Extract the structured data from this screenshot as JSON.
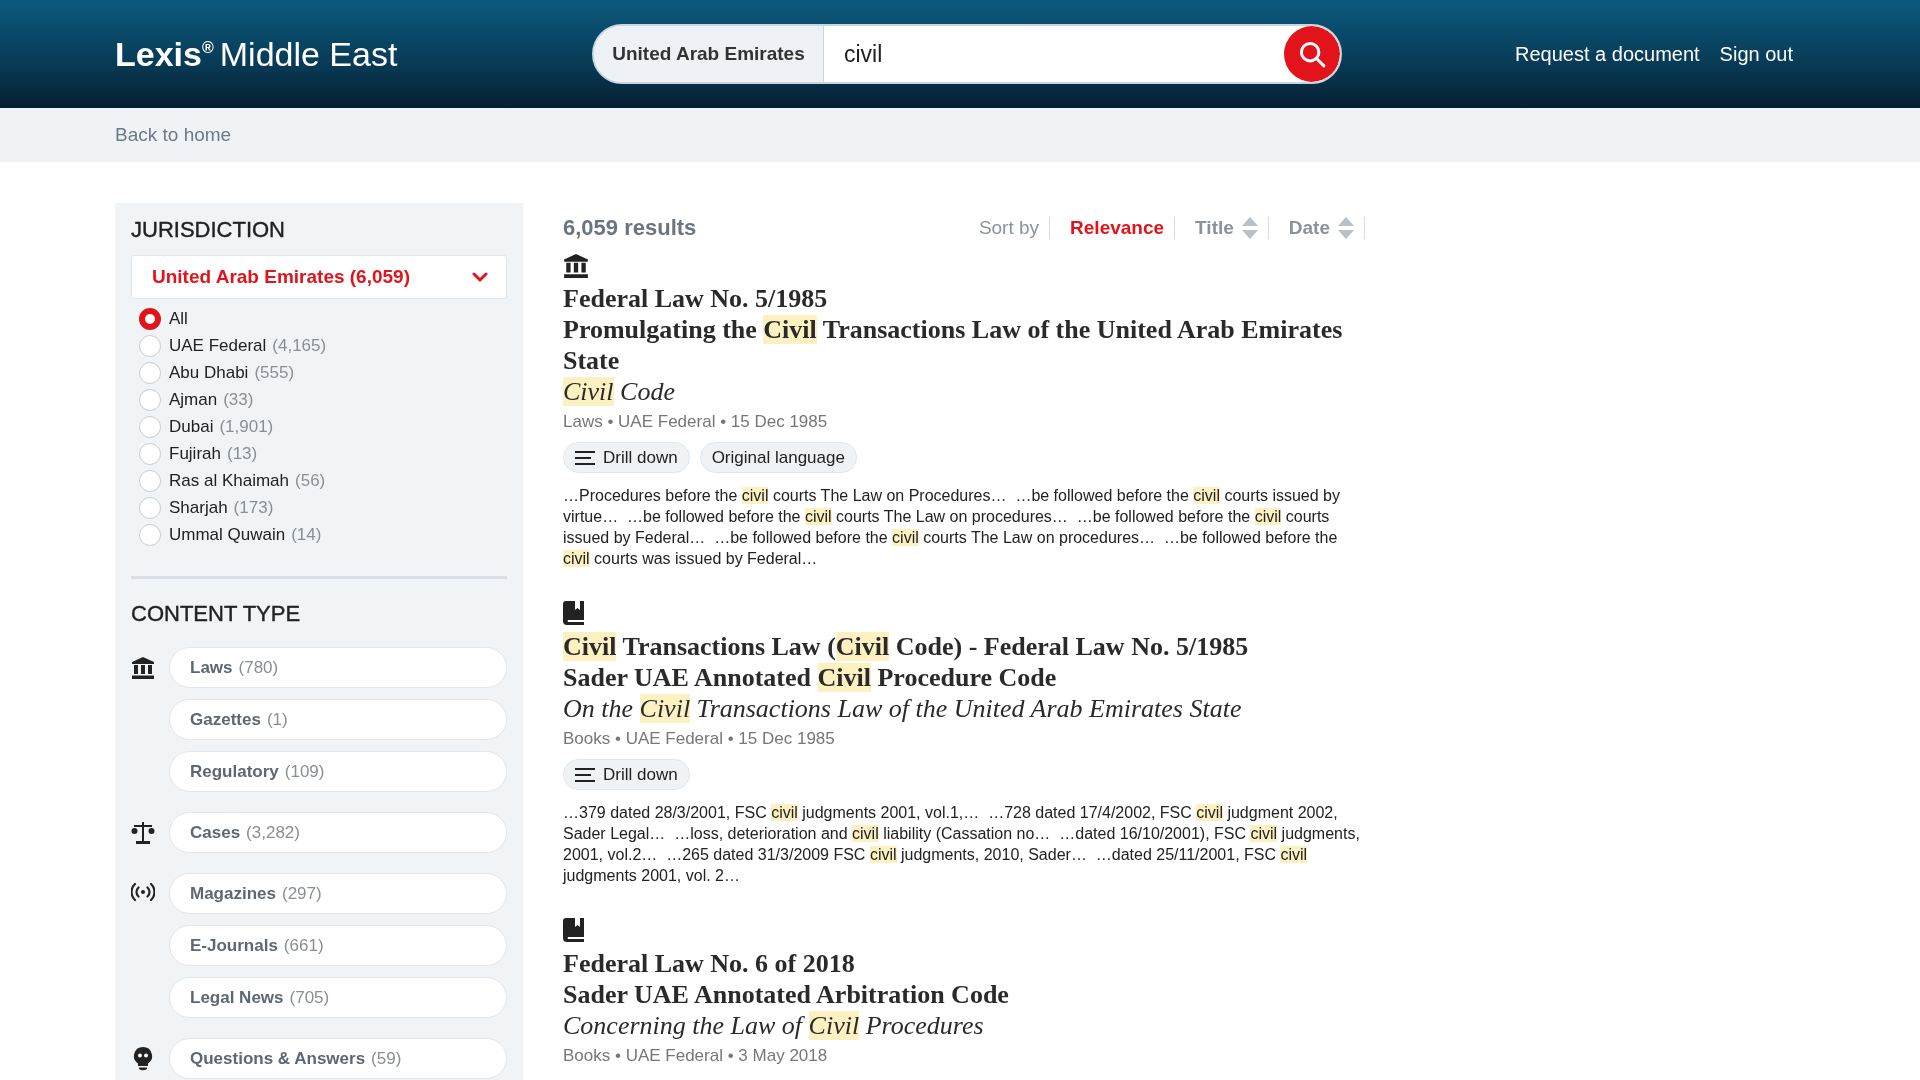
{
  "header": {
    "logo": {
      "brand": "Lexis",
      "mark": "®",
      "suffix": "Middle East"
    },
    "search": {
      "scope": "United Arab Emirates",
      "value": "civil"
    },
    "links": [
      "Request a document",
      "Sign out"
    ]
  },
  "back_link": "Back to home",
  "sidebar": {
    "jurisdiction": {
      "heading": "JURISDICTION",
      "dropdown": "United Arab Emirates (6,059)",
      "options": [
        {
          "label": "All",
          "selected": true
        },
        {
          "label": "UAE Federal",
          "count": "(4,165)",
          "selected": false
        },
        {
          "label": "Abu Dhabi",
          "count": "(555)",
          "selected": false
        },
        {
          "label": "Ajman",
          "count": "(33)",
          "selected": false
        },
        {
          "label": "Dubai",
          "count": "(1,901)",
          "selected": false
        },
        {
          "label": "Fujirah",
          "count": "(13)",
          "selected": false
        },
        {
          "label": "Ras al Khaimah",
          "count": "(56)",
          "selected": false
        },
        {
          "label": "Sharjah",
          "count": "(173)",
          "selected": false
        },
        {
          "label": "Ummal Quwain",
          "count": "(14)",
          "selected": false
        }
      ]
    },
    "content_type": {
      "heading": "CONTENT TYPE",
      "groups": [
        {
          "kind": "laws",
          "items": [
            {
              "label": "Laws",
              "count": "(780)"
            },
            {
              "label": "Gazettes",
              "count": "(1)"
            },
            {
              "label": "Regulatory",
              "count": "(109)"
            }
          ]
        },
        {
          "kind": "cases",
          "items": [
            {
              "label": "Cases",
              "count": "(3,282)"
            }
          ]
        },
        {
          "kind": "magazines",
          "items": [
            {
              "label": "Magazines",
              "count": "(297)"
            },
            {
              "label": "E-Journals",
              "count": "(661)"
            },
            {
              "label": "Legal News",
              "count": "(705)"
            }
          ]
        },
        {
          "kind": "qa",
          "items": [
            {
              "label": "Questions & Answers",
              "count": "(59)"
            }
          ]
        }
      ]
    }
  },
  "results": {
    "count": "6,059 results",
    "sort": {
      "label": "Sort by",
      "options": [
        {
          "label": "Relevance",
          "selected": true,
          "sortable": false
        },
        {
          "label": "Title",
          "selected": false,
          "sortable": true
        },
        {
          "label": "Date",
          "selected": false,
          "sortable": true
        }
      ]
    },
    "items": [
      {
        "kind": "law",
        "title_lines": [
          [
            {
              "text": "Federal Law No. 5/1985",
              "highlighted": false
            }
          ],
          [
            {
              "text": "Promulgating the ",
              "highlighted": false
            },
            {
              "text": "Civil",
              "highlighted": true
            },
            {
              "text": " Transactions Law of the United Arab Emirates State",
              "highlighted": false
            }
          ]
        ],
        "subtitle": [
          {
            "text": "Civil",
            "highlighted": true
          },
          {
            "text": " Code",
            "highlighted": false
          }
        ],
        "meta": "Laws • UAE Federal • 15 Dec 1985",
        "actions": [
          {
            "kind": "drill",
            "label": "Drill down"
          },
          {
            "kind": "plain",
            "label": "Original language"
          }
        ],
        "snippet": [
          {
            "text": "…Procedures before the ",
            "highlighted": false
          },
          {
            "text": "civil",
            "highlighted": true
          },
          {
            "text": " courts The Law on Procedures…  …be followed before the ",
            "highlighted": false
          },
          {
            "text": "civil",
            "highlighted": true
          },
          {
            "text": " courts issued by virtue…  …be followed before the ",
            "highlighted": false
          },
          {
            "text": "civil",
            "highlighted": true
          },
          {
            "text": " courts The Law on procedures…  …be followed before the ",
            "highlighted": false
          },
          {
            "text": "civil",
            "highlighted": true
          },
          {
            "text": " courts issued by Federal…  …be followed before the ",
            "highlighted": false
          },
          {
            "text": "civil",
            "highlighted": true
          },
          {
            "text": " courts The Law on procedures…  …be followed before the ",
            "highlighted": false
          },
          {
            "text": "civil",
            "highlighted": true
          },
          {
            "text": " courts was issued by Federal…",
            "highlighted": false
          }
        ]
      },
      {
        "kind": "book",
        "title_lines": [
          [
            {
              "text": "Civil",
              "highlighted": true
            },
            {
              "text": " Transactions Law (",
              "highlighted": false
            },
            {
              "text": "Civil",
              "highlighted": true
            },
            {
              "text": " Code) - Federal Law No. 5/1985",
              "highlighted": false
            }
          ],
          [
            {
              "text": "Sader UAE Annotated ",
              "highlighted": false
            },
            {
              "text": "Civil",
              "highlighted": true
            },
            {
              "text": " Procedure Code",
              "highlighted": false
            }
          ]
        ],
        "subtitle": [
          {
            "text": "On the ",
            "highlighted": false
          },
          {
            "text": "Civil",
            "highlighted": true
          },
          {
            "text": " Transactions Law of the United Arab Emirates State",
            "highlighted": false
          }
        ],
        "meta": "Books • UAE Federal • 15 Dec 1985",
        "actions": [
          {
            "kind": "drill",
            "label": "Drill down"
          }
        ],
        "snippet": [
          {
            "text": "…379 dated 28/3/2001, FSC ",
            "highlighted": false
          },
          {
            "text": "civil",
            "highlighted": true
          },
          {
            "text": " judgments 2001, vol.1,…  …728 dated 17/4/2002, FSC ",
            "highlighted": false
          },
          {
            "text": "civil",
            "highlighted": true
          },
          {
            "text": " judgment 2002, Sader Legal…  …loss, deterioration and ",
            "highlighted": false
          },
          {
            "text": "civil",
            "highlighted": true
          },
          {
            "text": " liability (Cassation no…  …dated 16/10/2001), FSC ",
            "highlighted": false
          },
          {
            "text": "civil",
            "highlighted": true
          },
          {
            "text": " judgments, 2001, vol.2…  …265 dated 31/3/2009 FSC ",
            "highlighted": false
          },
          {
            "text": "civil",
            "highlighted": true
          },
          {
            "text": " judgments, 2010, Sader…  …dated 25/11/2001, FSC ",
            "highlighted": false
          },
          {
            "text": "civil",
            "highlighted": true
          },
          {
            "text": " judgments 2001, vol. 2…",
            "highlighted": false
          }
        ]
      },
      {
        "kind": "book",
        "title_lines": [
          [
            {
              "text": "Federal Law No. 6 of 2018",
              "highlighted": false
            }
          ],
          [
            {
              "text": "Sader UAE Annotated Arbitration Code",
              "highlighted": false
            }
          ]
        ],
        "subtitle": [
          {
            "text": "Concerning the Law of ",
            "highlighted": false
          },
          {
            "text": "Civil",
            "highlighted": true
          },
          {
            "text": " Procedures",
            "highlighted": false
          }
        ],
        "meta": "Books • UAE Federal • 3 May 2018"
      }
    ]
  }
}
